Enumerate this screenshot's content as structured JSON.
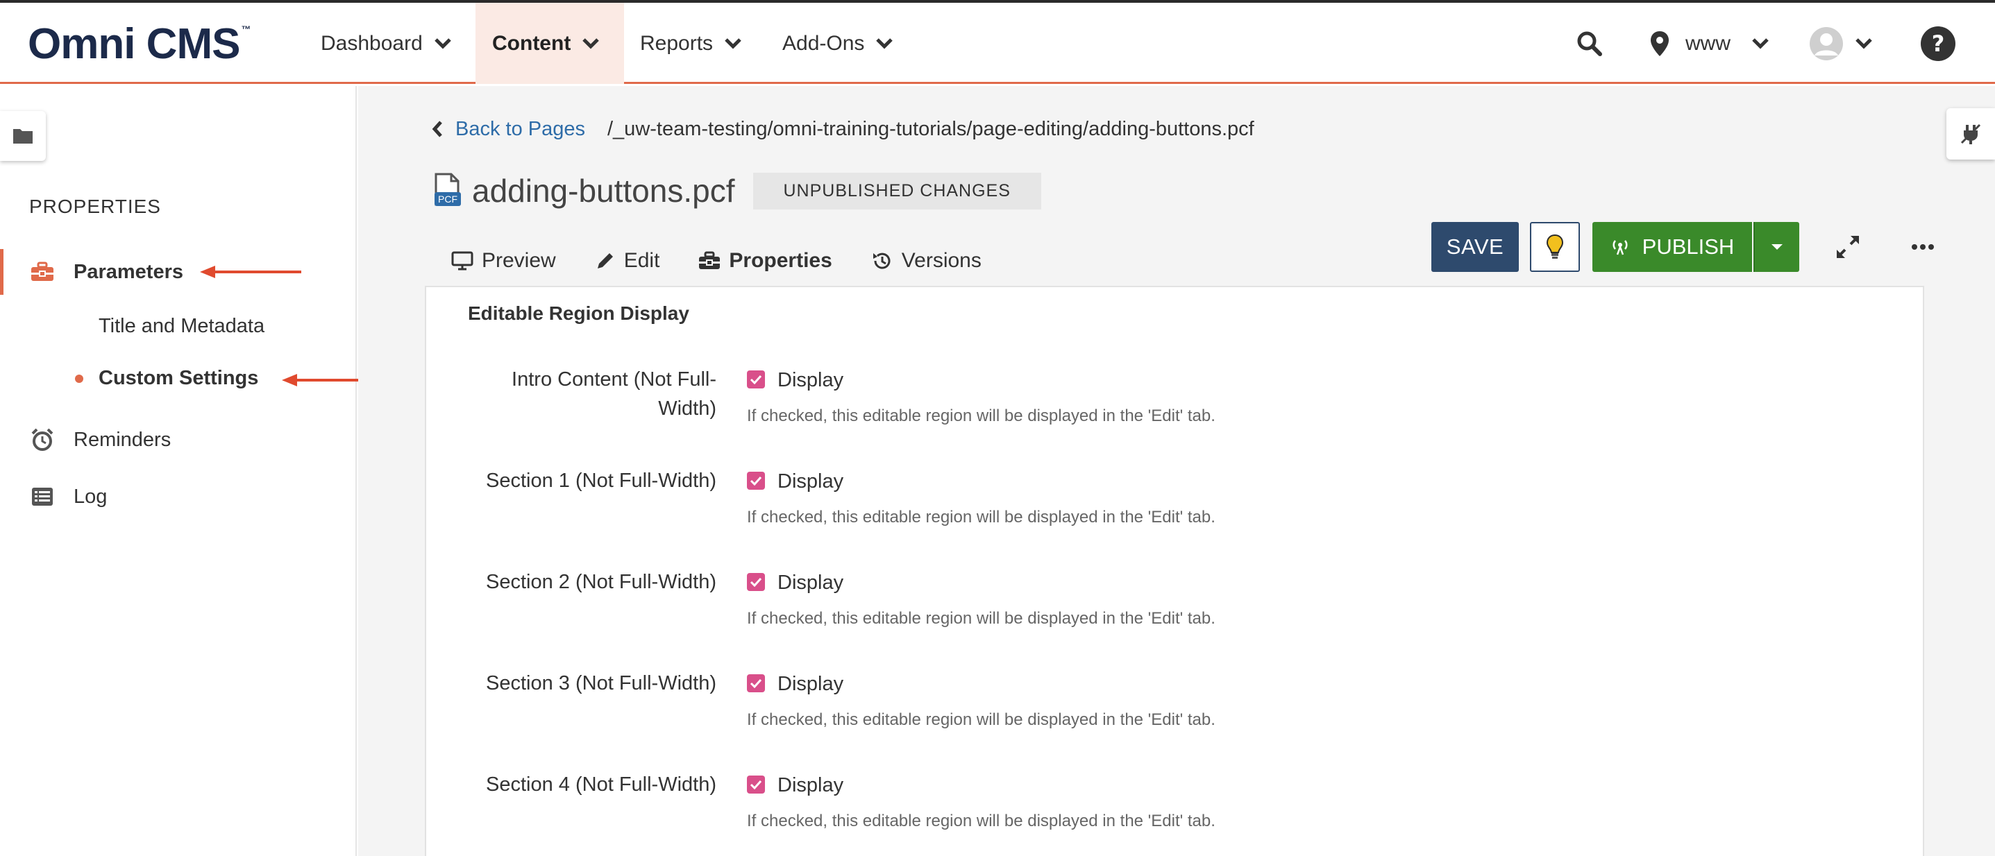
{
  "app": {
    "logo_text": "Omni CMS",
    "logo_tm": "™"
  },
  "nav": {
    "items": [
      {
        "label": "Dashboard"
      },
      {
        "label": "Content",
        "active": true
      },
      {
        "label": "Reports"
      },
      {
        "label": "Add-Ons"
      }
    ],
    "site_label": "www"
  },
  "sidebar": {
    "heading": "PROPERTIES",
    "items": [
      {
        "label": "Parameters",
        "icon": "toolbox-icon",
        "active": true
      },
      {
        "label": "Title and Metadata"
      },
      {
        "label": "Custom Settings",
        "current": true
      },
      {
        "label": "Reminders",
        "icon": "alarm-clock-icon"
      },
      {
        "label": "Log",
        "icon": "list-icon"
      }
    ]
  },
  "breadcrumb": {
    "back_label": "Back to Pages",
    "path": "/_uw-team-testing/omni-training-tutorials/page-editing/adding-buttons.pcf"
  },
  "page": {
    "file_name": "adding-buttons.pcf",
    "file_badge": "PCF",
    "status_badge": "UNPUBLISHED CHANGES"
  },
  "tabs": [
    {
      "label": "Preview",
      "icon": "monitor-icon"
    },
    {
      "label": "Edit",
      "icon": "pencil-icon"
    },
    {
      "label": "Properties",
      "icon": "toolbox-icon",
      "active": true
    },
    {
      "label": "Versions",
      "icon": "history-icon"
    }
  ],
  "toolbar": {
    "save_label": "SAVE",
    "publish_label": "PUBLISH"
  },
  "panel": {
    "title": "Editable Region Display",
    "rows": [
      {
        "label_line1": "Intro Content (Not Full-",
        "label_line2": "Width)",
        "checkbox_label": "Display",
        "checked": true,
        "help": "If checked, this editable region will be displayed in the 'Edit' tab."
      },
      {
        "label_line1": "Section 1 (Not Full-Width)",
        "label_line2": "",
        "checkbox_label": "Display",
        "checked": true,
        "help": "If checked, this editable region will be displayed in the 'Edit' tab."
      },
      {
        "label_line1": "Section 2 (Not Full-Width)",
        "label_line2": "",
        "checkbox_label": "Display",
        "checked": true,
        "help": "If checked, this editable region will be displayed in the 'Edit' tab."
      },
      {
        "label_line1": "Section 3 (Not Full-Width)",
        "label_line2": "",
        "checkbox_label": "Display",
        "checked": true,
        "help": "If checked, this editable region will be displayed in the 'Edit' tab."
      },
      {
        "label_line1": "Section 4 (Not Full-Width)",
        "label_line2": "",
        "checkbox_label": "Display",
        "checked": true,
        "help": "If checked, this editable region will be displayed in the 'Edit' tab."
      }
    ]
  },
  "colors": {
    "accent": "#e06a4a",
    "navy": "#2e4a6d",
    "publish_green": "#3a8a2a",
    "checkbox": "#d94f8a",
    "link": "#2e6ca8"
  }
}
